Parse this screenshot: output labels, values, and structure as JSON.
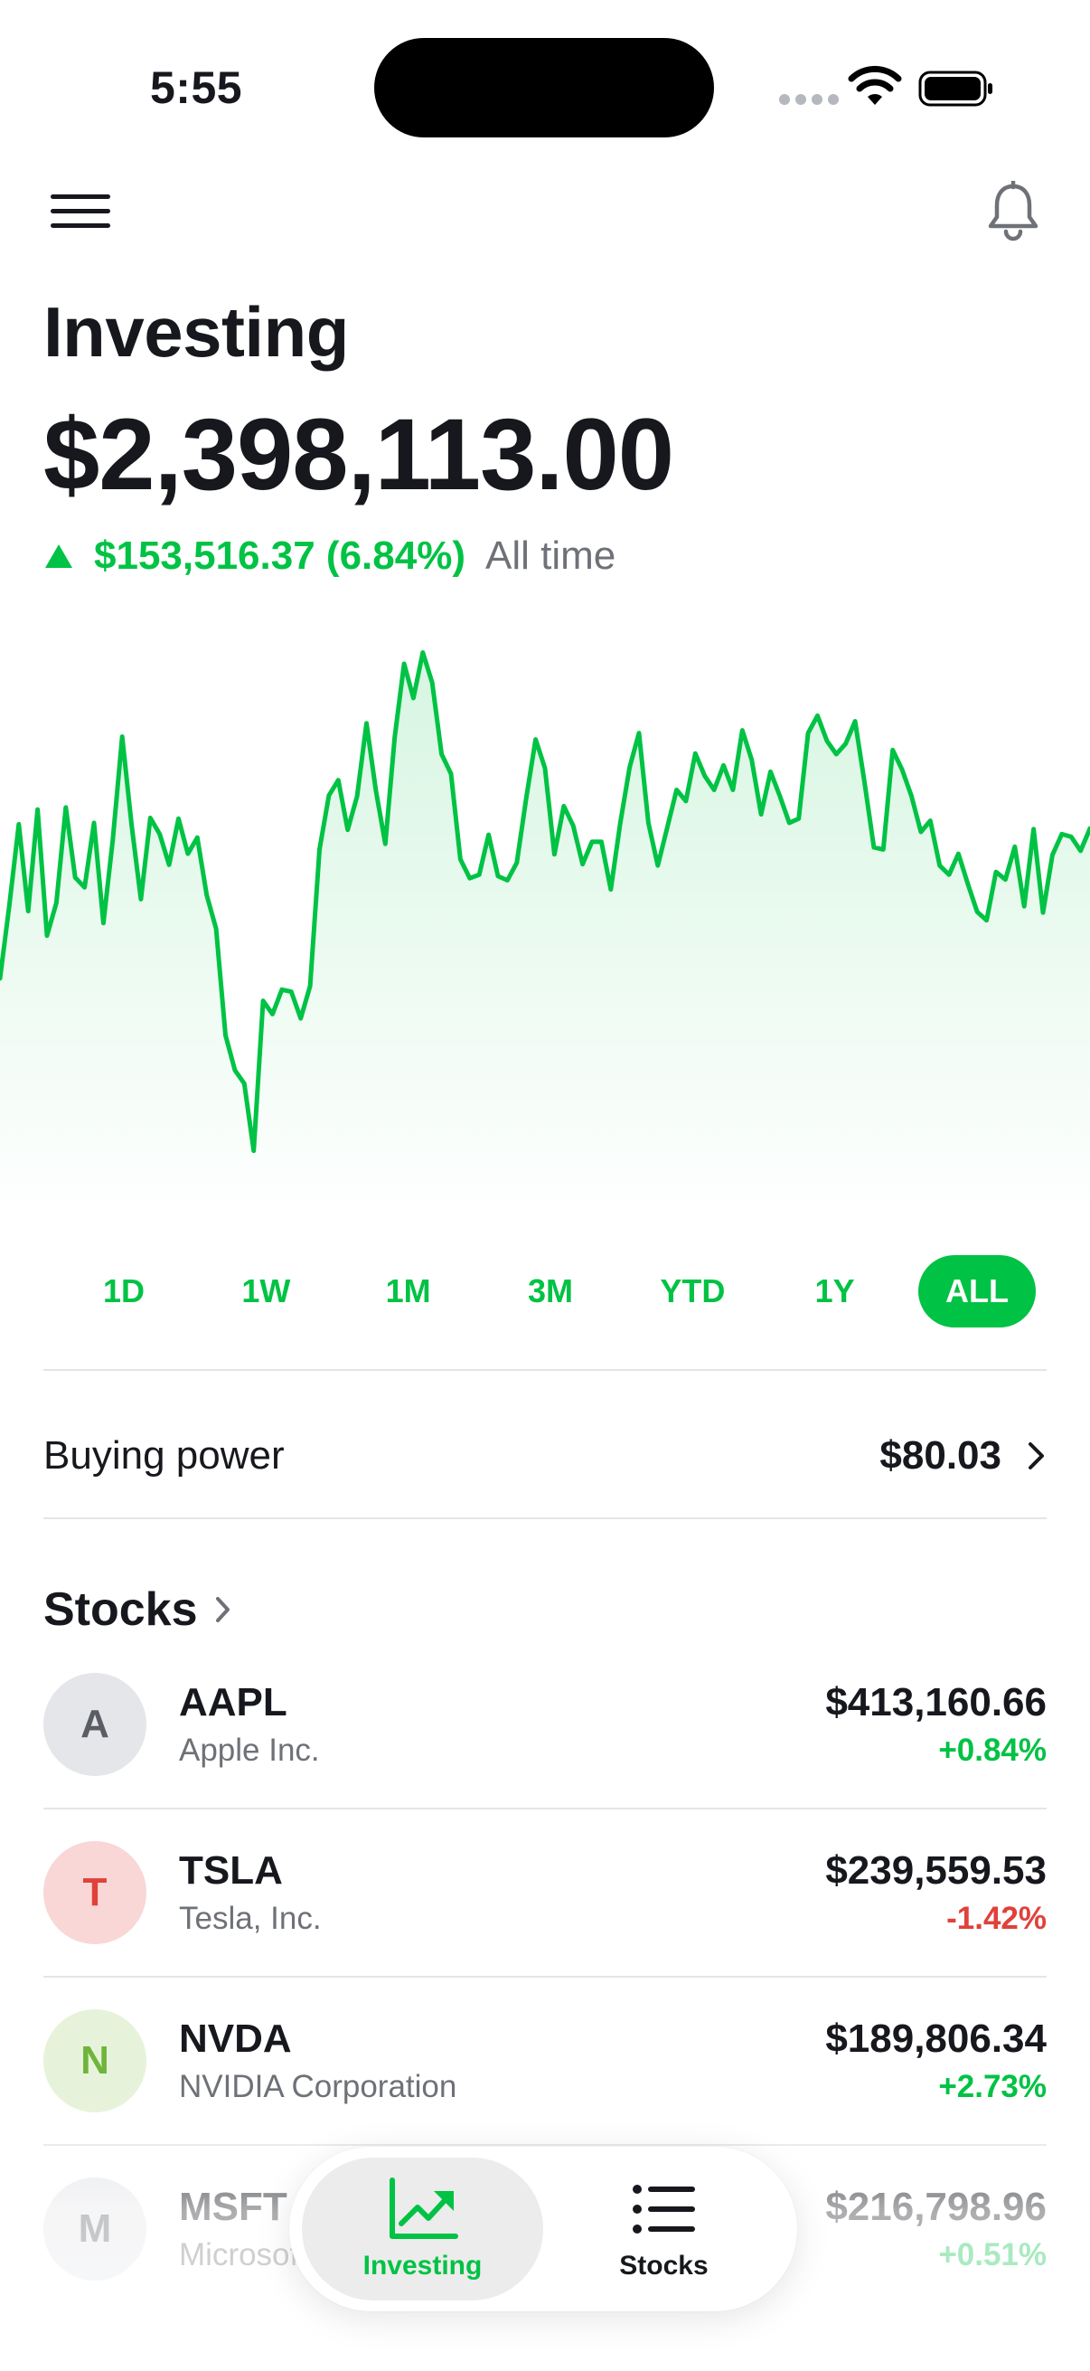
{
  "status_bar": {
    "time": "5:55"
  },
  "header": {
    "menu_icon": "menu-icon",
    "notifications_icon": "bell-icon"
  },
  "page_title": "Investing",
  "portfolio": {
    "value": "$2,398,113.00",
    "gain": "$153,516.37 (6.84%)",
    "gain_period": "All time",
    "direction": "up"
  },
  "chart_data": {
    "type": "area",
    "title": "",
    "xlabel": "",
    "ylabel": "",
    "color": "#00c244",
    "values": [
      52.0,
      62.5,
      74.0,
      61.6,
      76.1,
      58.1,
      62.8,
      76.4,
      66.4,
      65.0,
      74.2,
      59.9,
      71.8,
      86.5,
      73.9,
      63.3,
      74.9,
      72.6,
      68.2,
      74.8,
      69.8,
      72.1,
      63.9,
      59.1,
      43.9,
      38.9,
      37.0,
      27.4,
      48.8,
      46.9,
      50.4,
      50.1,
      46.3,
      50.9,
      70.4,
      78.1,
      80.3,
      73.2,
      78.0,
      88.4,
      78.8,
      71.2,
      86.4,
      96.9,
      92.0,
      98.5,
      94.2,
      84.0,
      81.2,
      69.0,
      66.3,
      66.8,
      72.5,
      66.6,
      66.0,
      68.5,
      77.7,
      86.1,
      82.0,
      69.7,
      76.6,
      73.8,
      68.3,
      71.5,
      71.5,
      64.7,
      74.1,
      82.1,
      87.0,
      74.2,
      68.1,
      73.5,
      78.9,
      77.3,
      84.1,
      80.9,
      78.9,
      82.4,
      78.9,
      87.4,
      83.2,
      75.4,
      81.5,
      78.0,
      74.2,
      74.8,
      87.0,
      89.5,
      85.9,
      84.0,
      85.5,
      88.7,
      80.0,
      70.7,
      70.4,
      84.6,
      81.8,
      78.0,
      72.9,
      74.5,
      68.1,
      66.8,
      69.8,
      65.5,
      61.5,
      60.3,
      67.2,
      66.1,
      70.8,
      62.3,
      73.3,
      61.4,
      69.6,
      72.6,
      72.2,
      70.2,
      73.4
    ],
    "ylim": [
      20,
      100
    ],
    "ranges": [
      "1D",
      "1W",
      "1M",
      "3M",
      "YTD",
      "1Y",
      "ALL"
    ],
    "selected_range": "ALL",
    "grid": false
  },
  "buying_power": {
    "label": "Buying power",
    "value": "$80.03"
  },
  "stocks_section": {
    "title": "Stocks"
  },
  "stocks": [
    {
      "letter": "A",
      "ticker": "AAPL",
      "name": "Apple Inc.",
      "price": "$413,160.66",
      "change": "+0.84%",
      "direction": "up",
      "avatar_bg": "#e5e6e9",
      "avatar_fg": "#5a5d63"
    },
    {
      "letter": "T",
      "ticker": "TSLA",
      "name": "Tesla, Inc.",
      "price": "$239,559.53",
      "change": "-1.42%",
      "direction": "down",
      "avatar_bg": "#f8d7d6",
      "avatar_fg": "#e0413b"
    },
    {
      "letter": "N",
      "ticker": "NVDA",
      "name": "NVIDIA Corporation",
      "price": "$189,806.34",
      "change": "+2.73%",
      "direction": "up",
      "avatar_bg": "#e6f3da",
      "avatar_fg": "#6fb53c"
    },
    {
      "letter": "M",
      "ticker": "MSFT",
      "name": "Microsoft Corporation",
      "price": "$216,798.96",
      "change": "+0.51%",
      "direction": "up",
      "avatar_bg": "#e5e6e9",
      "avatar_fg": "#5a5d63"
    }
  ],
  "tab_bar": {
    "tabs": [
      {
        "label": "Investing",
        "icon": "chart-trend-icon",
        "active": true
      },
      {
        "label": "Stocks",
        "icon": "list-icon",
        "active": false
      }
    ]
  },
  "colors": {
    "accent": "#00c244",
    "negative": "#e0413b",
    "text": "#16181d",
    "muted": "#6e7177"
  }
}
